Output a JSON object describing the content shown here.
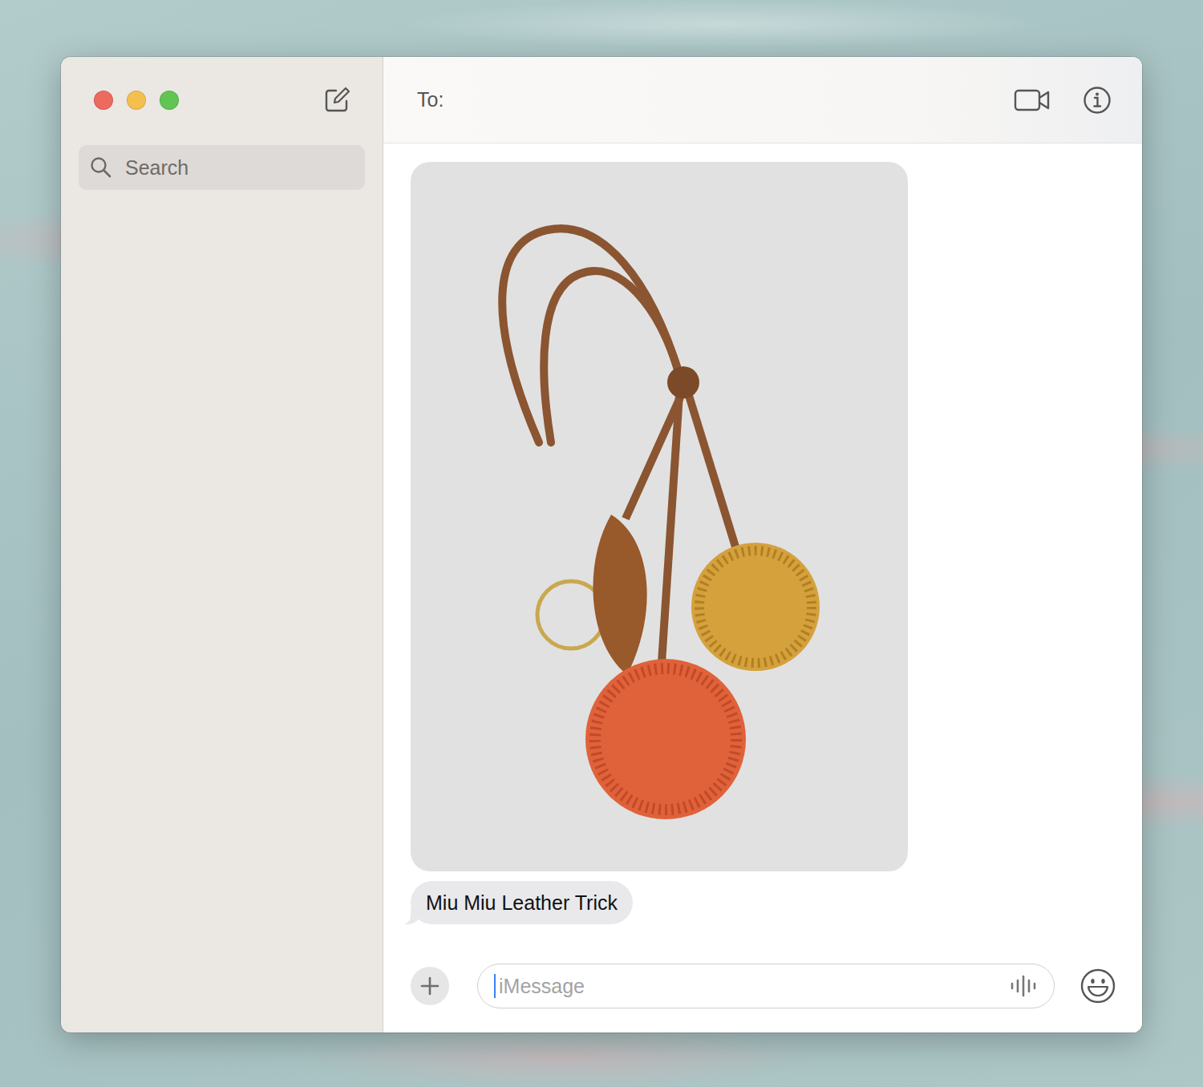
{
  "window": {
    "traffic_lights": [
      {
        "color": "#ed6a5e"
      },
      {
        "color": "#f5bf4f"
      },
      {
        "color": "#61c554"
      }
    ]
  },
  "sidebar": {
    "search": {
      "placeholder": "Search"
    }
  },
  "header": {
    "to_label": "To:"
  },
  "messages": [
    {
      "kind": "image"
    },
    {
      "kind": "text",
      "text": "Miu Miu Leather Trick"
    }
  ],
  "composer": {
    "placeholder": "iMessage"
  }
}
